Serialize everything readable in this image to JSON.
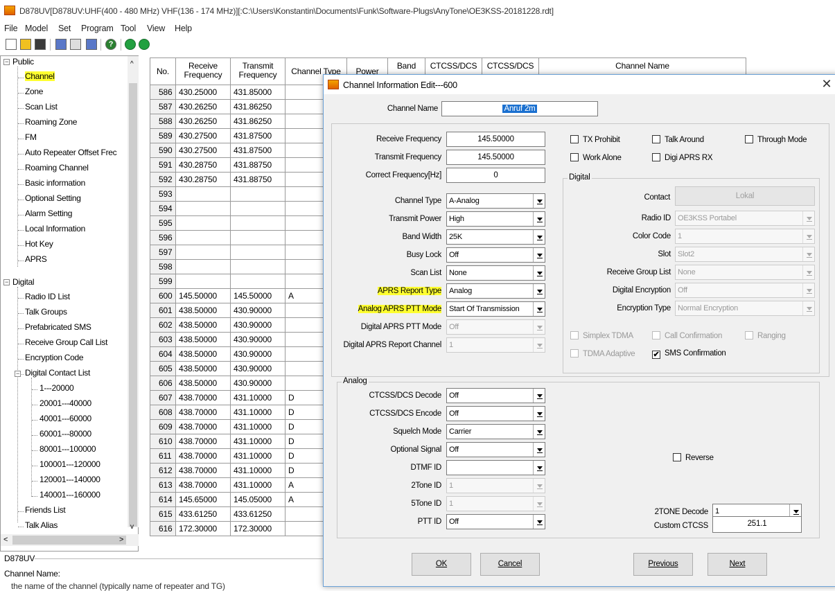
{
  "window": {
    "title": "D878UV[D878UV:UHF(400 - 480 MHz) VHF(136 - 174 MHz)][:C:\\Users\\Konstantin\\Documents\\Funk\\Software-Plugs\\AnyTone\\OE3KSS-20181228.rdt]"
  },
  "menu": [
    "File",
    "Model",
    "Set",
    "Program",
    "Tool",
    "View",
    "Help"
  ],
  "toolbar": {
    "icons": [
      "new-icon",
      "open-icon",
      "save-icon",
      "read-radio-icon",
      "write-radio-icon",
      "export-icon",
      "help-icon",
      "up-icon",
      "down-icon"
    ],
    "help_glyph": "?"
  },
  "tree": {
    "public": "Public",
    "public_items": [
      "Channel",
      "Zone",
      "Scan List",
      "Roaming Zone",
      "FM",
      "Auto Repeater Offset Frec",
      "Roaming Channel",
      "Basic information",
      "Optional Setting",
      "Alarm Setting",
      "Local Information",
      "Hot Key",
      "APRS"
    ],
    "digital": "Digital",
    "digital_items": [
      "Radio ID List",
      "Talk Groups",
      "Prefabricated SMS",
      "Receive Group Call List",
      "Encryption Code",
      "Digital Contact List"
    ],
    "contact_ranges": [
      "1---20000",
      "20001---40000",
      "40001---60000",
      "60001---80000",
      "80001---100000",
      "100001---120000",
      "120001---140000",
      "140001---160000"
    ],
    "digital_tail": [
      "Friends List",
      "Talk Alias"
    ],
    "selected": "Channel"
  },
  "status": {
    "device_label": "D878UV",
    "field_title": "Channel Name:",
    "field_description": "the name of the channel (typically name of repeater and TG)"
  },
  "grid": {
    "headers": {
      "no": "No.",
      "rx": "Receive Frequency",
      "tx": "Transmit Frequency",
      "ctype": "Channel Type",
      "power": "Power",
      "band": "Band",
      "ctcss1": "CTCSS/DCS",
      "ctcss2": "CTCSS/DCS",
      "name": "Channel Name"
    },
    "rows": [
      {
        "no": "586",
        "rx": "430.25000",
        "tx": "431.85000",
        "ct": ""
      },
      {
        "no": "587",
        "rx": "430.26250",
        "tx": "431.86250",
        "ct": ""
      },
      {
        "no": "588",
        "rx": "430.26250",
        "tx": "431.86250",
        "ct": ""
      },
      {
        "no": "589",
        "rx": "430.27500",
        "tx": "431.87500",
        "ct": ""
      },
      {
        "no": "590",
        "rx": "430.27500",
        "tx": "431.87500",
        "ct": ""
      },
      {
        "no": "591",
        "rx": "430.28750",
        "tx": "431.88750",
        "ct": ""
      },
      {
        "no": "592",
        "rx": "430.28750",
        "tx": "431.88750",
        "ct": ""
      },
      {
        "no": "593",
        "rx": "",
        "tx": "",
        "ct": ""
      },
      {
        "no": "594",
        "rx": "",
        "tx": "",
        "ct": ""
      },
      {
        "no": "595",
        "rx": "",
        "tx": "",
        "ct": ""
      },
      {
        "no": "596",
        "rx": "",
        "tx": "",
        "ct": ""
      },
      {
        "no": "597",
        "rx": "",
        "tx": "",
        "ct": ""
      },
      {
        "no": "598",
        "rx": "",
        "tx": "",
        "ct": ""
      },
      {
        "no": "599",
        "rx": "",
        "tx": "",
        "ct": ""
      },
      {
        "no": "600",
        "rx": "145.50000",
        "tx": "145.50000",
        "ct": "A"
      },
      {
        "no": "601",
        "rx": "438.50000",
        "tx": "430.90000",
        "ct": ""
      },
      {
        "no": "602",
        "rx": "438.50000",
        "tx": "430.90000",
        "ct": ""
      },
      {
        "no": "603",
        "rx": "438.50000",
        "tx": "430.90000",
        "ct": ""
      },
      {
        "no": "604",
        "rx": "438.50000",
        "tx": "430.90000",
        "ct": ""
      },
      {
        "no": "605",
        "rx": "438.50000",
        "tx": "430.90000",
        "ct": ""
      },
      {
        "no": "606",
        "rx": "438.50000",
        "tx": "430.90000",
        "ct": ""
      },
      {
        "no": "607",
        "rx": "438.70000",
        "tx": "431.10000",
        "ct": "D"
      },
      {
        "no": "608",
        "rx": "438.70000",
        "tx": "431.10000",
        "ct": "D"
      },
      {
        "no": "609",
        "rx": "438.70000",
        "tx": "431.10000",
        "ct": "D"
      },
      {
        "no": "610",
        "rx": "438.70000",
        "tx": "431.10000",
        "ct": "D"
      },
      {
        "no": "611",
        "rx": "438.70000",
        "tx": "431.10000",
        "ct": "D"
      },
      {
        "no": "612",
        "rx": "438.70000",
        "tx": "431.10000",
        "ct": "D"
      },
      {
        "no": "613",
        "rx": "438.70000",
        "tx": "431.10000",
        "ct": "A"
      },
      {
        "no": "614",
        "rx": "145.65000",
        "tx": "145.05000",
        "ct": "A"
      },
      {
        "no": "615",
        "rx": "433.61250",
        "tx": "433.61250",
        "ct": ""
      },
      {
        "no": "616",
        "rx": "172.30000",
        "tx": "172.30000",
        "ct": ""
      }
    ]
  },
  "dialog": {
    "title": "Channel Information Edit---600",
    "close_glyph": "✕",
    "channel_name_label": "Channel Name",
    "channel_name_value": "Anruf 2m",
    "rx_freq_label": "Receive Frequency",
    "rx_freq_value": "145.50000",
    "tx_freq_label": "Transmit Frequency",
    "tx_freq_value": "145.50000",
    "correct_freq_label": "Correct Frequency[Hz]",
    "correct_freq_value": "0",
    "checks": {
      "tx_prohibit": "TX Prohibit",
      "talk_around": "Talk Around",
      "through_mode": "Through Mode",
      "work_alone": "Work Alone",
      "digi_aprs_rx": "Digi APRS RX",
      "simplex_tdma": "Simplex TDMA",
      "call_confirmation": "Call Confirmation",
      "ranging": "Ranging",
      "tdma_adaptive": "TDMA Adaptive",
      "sms_confirmation": "SMS Confirmation",
      "reverse": "Reverse",
      "check_mark": "✔"
    },
    "left_fields": {
      "channel_type": {
        "label": "Channel Type",
        "value": "A-Analog"
      },
      "transmit_power": {
        "label": "Transmit Power",
        "value": "High"
      },
      "band_width": {
        "label": "Band Width",
        "value": "25K"
      },
      "busy_lock": {
        "label": "Busy Lock",
        "value": "Off"
      },
      "scan_list": {
        "label": "Scan List",
        "value": "None"
      },
      "aprs_report_type": {
        "label": "APRS Report Type",
        "value": "Analog"
      },
      "analog_aprs_ptt": {
        "label": "Analog APRS PTT Mode",
        "value": "Start Of Transmission"
      },
      "digital_aprs_ptt": {
        "label": "Digital APRS PTT Mode",
        "value": "Off"
      },
      "digital_aprs_channel": {
        "label": "Digital APRS Report Channel",
        "value": "1"
      }
    },
    "digital": {
      "group_title": "Digital",
      "contact_label": "Contact",
      "contact_value": "Lokal",
      "radio_id": {
        "label": "Radio ID",
        "value": "OE3KSS Portabel"
      },
      "color_code": {
        "label": "Color Code",
        "value": "1"
      },
      "slot": {
        "label": "Slot",
        "value": "Slot2"
      },
      "rx_group_list": {
        "label": "Receive Group List",
        "value": "None"
      },
      "digital_encryption": {
        "label": "Digital Encryption",
        "value": "Off"
      },
      "encryption_type": {
        "label": "Encryption Type",
        "value": "Normal Encryption"
      }
    },
    "analog": {
      "group_title": "Analog",
      "ctcss_decode": {
        "label": "CTCSS/DCS Decode",
        "value": "Off"
      },
      "ctcss_encode": {
        "label": "CTCSS/DCS Encode",
        "value": "Off"
      },
      "squelch_mode": {
        "label": "Squelch Mode",
        "value": "Carrier"
      },
      "optional_signal": {
        "label": "Optional Signal",
        "value": "Off"
      },
      "dtmf_id": {
        "label": "DTMF ID",
        "value": ""
      },
      "two_tone_id": {
        "label": "2Tone ID",
        "value": "1"
      },
      "five_tone_id": {
        "label": "5Tone ID",
        "value": "1"
      },
      "ptt_id": {
        "label": "PTT ID",
        "value": "Off"
      },
      "two_tone_decode": {
        "label": "2TONE Decode",
        "value": "1"
      },
      "custom_ctcss": {
        "label": "Custom CTCSS",
        "value": "251.1"
      }
    },
    "buttons": {
      "ok": "OK",
      "cancel": "Cancel",
      "previous": "Previous",
      "next": "Next"
    }
  }
}
